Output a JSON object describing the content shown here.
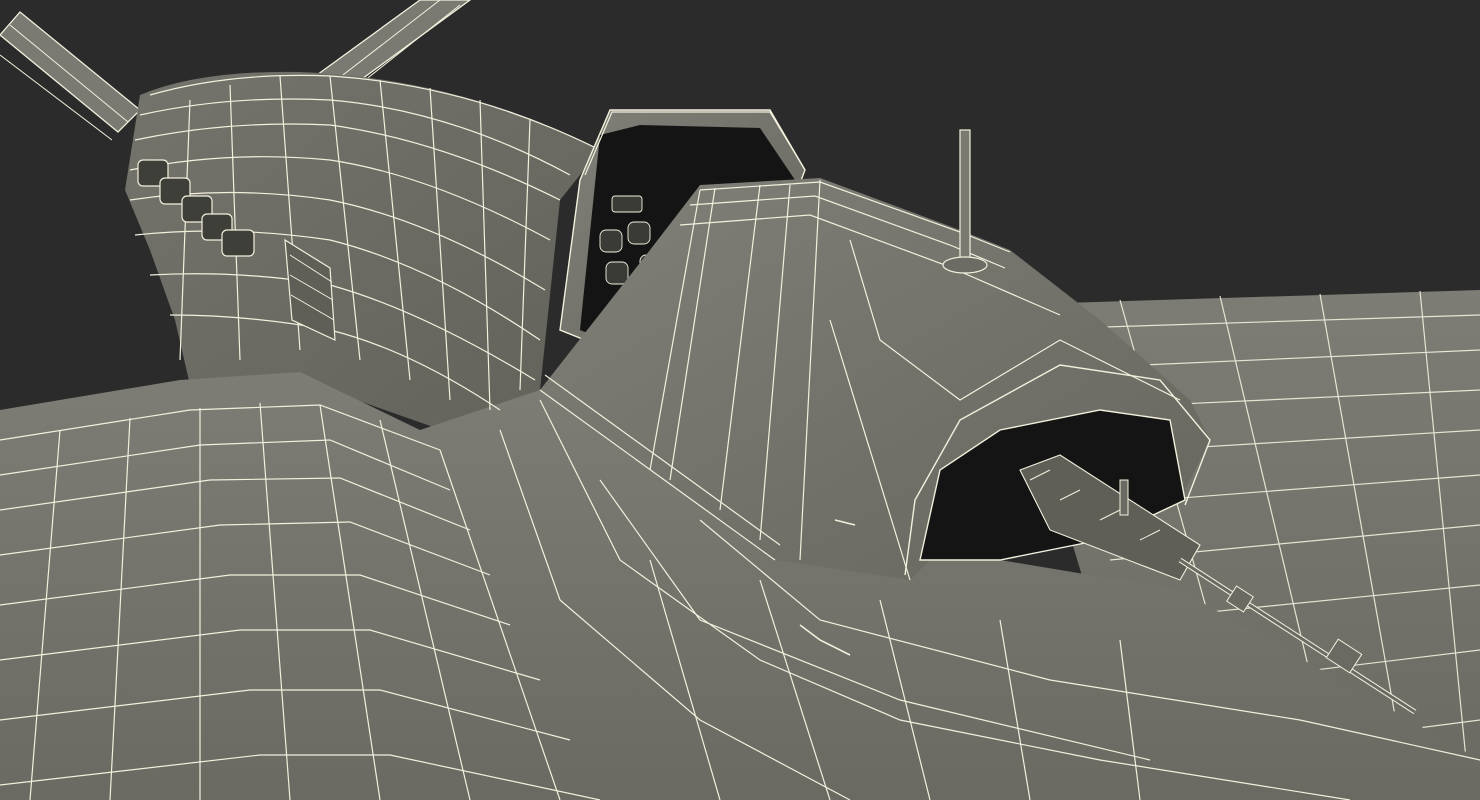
{
  "scene": {
    "subject": "wireframe-aircraft-render",
    "colors": {
      "background": "#2b2b2b",
      "surface": "#6f6f68",
      "surface_light": "#7b7b73",
      "surface_dark": "#57574f",
      "wire": "#f2f0dd",
      "cockpit_interior": "#141414",
      "instrument": "#3a3a36"
    }
  }
}
